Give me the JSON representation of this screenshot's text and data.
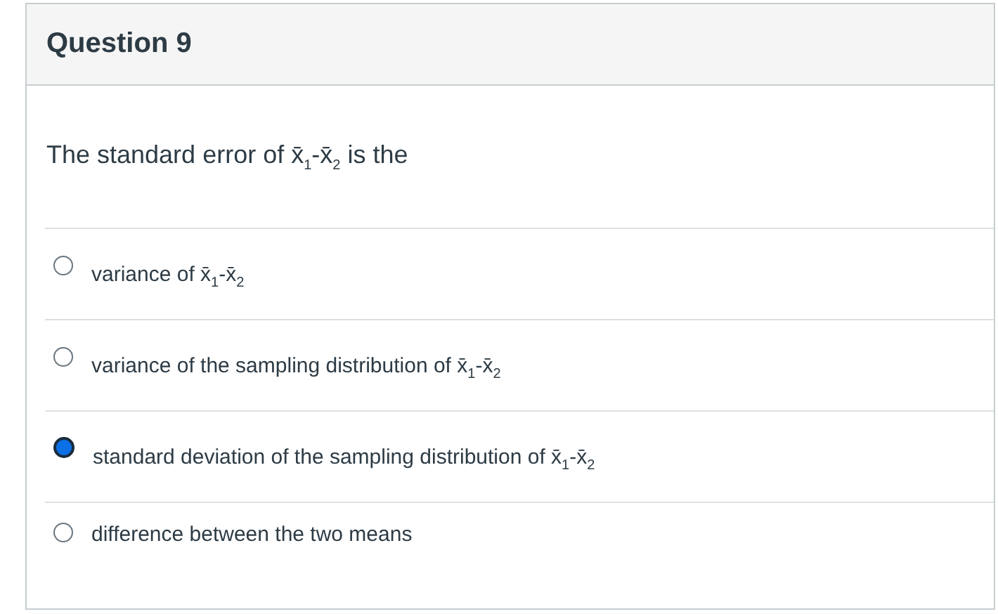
{
  "question": {
    "title": "Question 9",
    "text": "The standard error of x̄$_{1}$-x̄$_{2}$ is the"
  },
  "options": [
    {
      "text": "variance of x̄$_{1}$-x̄$_{2}$",
      "selected": false
    },
    {
      "text": "variance of the sampling distribution of x̄$_{1}$-x̄$_{2}$",
      "selected": false
    },
    {
      "text": "standard deviation of the sampling distribution of x̄$_{1}$-x̄$_{2}$",
      "selected": true
    },
    {
      "text": "difference between the two means",
      "selected": false
    }
  ]
}
